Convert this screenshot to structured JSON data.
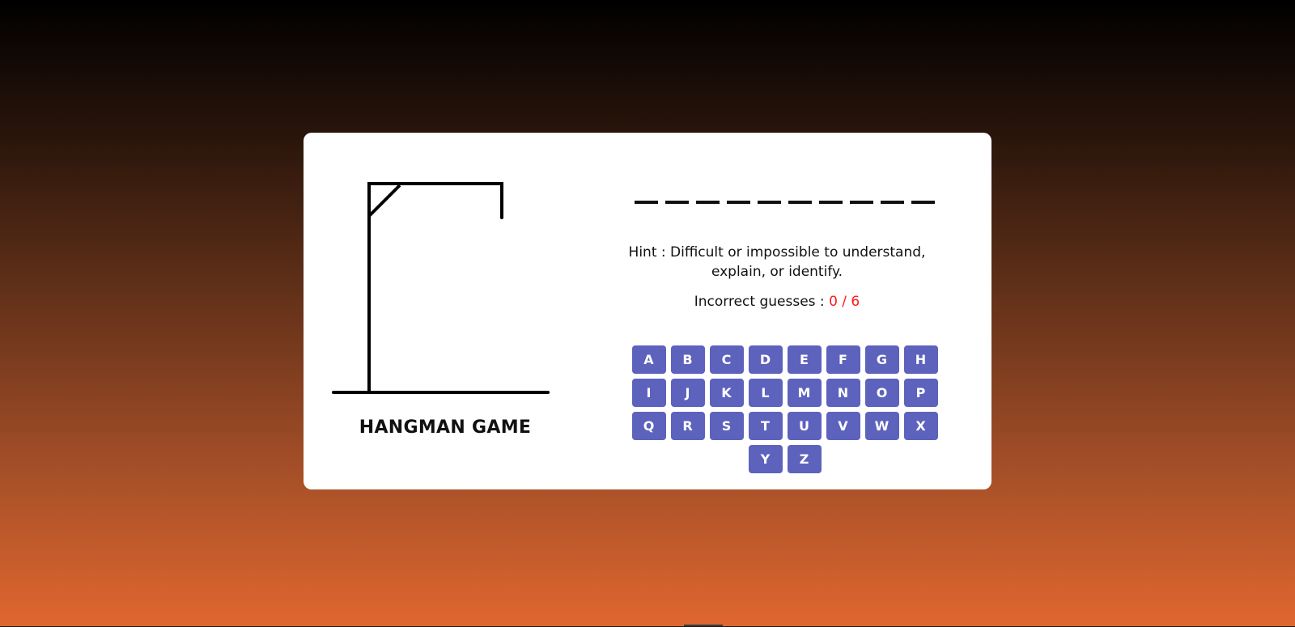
{
  "game": {
    "title": "HANGMAN GAME",
    "word_length": 10,
    "hint": "Hint : Difficult or impossible to understand, explain, or identify.",
    "incorrect_label": "Incorrect guesses : ",
    "incorrect_count": "0 / 6"
  },
  "keyboard": {
    "keys": [
      "A",
      "B",
      "C",
      "D",
      "E",
      "F",
      "G",
      "H",
      "I",
      "J",
      "K",
      "L",
      "M",
      "N",
      "O",
      "P",
      "Q",
      "R",
      "S",
      "T",
      "U",
      "V",
      "W",
      "X",
      "Y",
      "Z"
    ]
  },
  "colors": {
    "key_bg": "#5d62bd",
    "counter": "#ff1a1a"
  }
}
